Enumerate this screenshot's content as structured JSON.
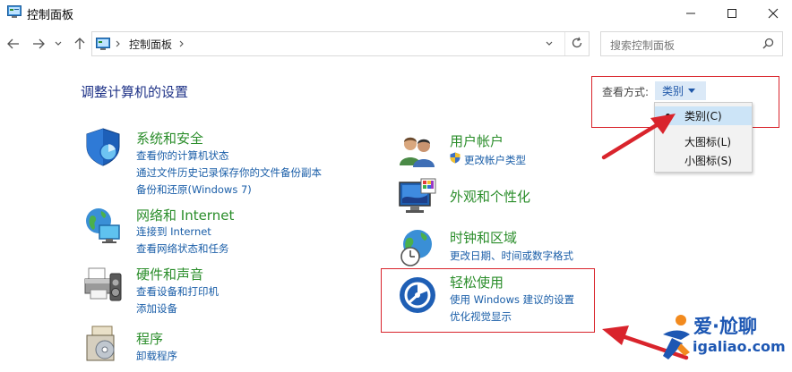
{
  "window": {
    "title": "控制面板"
  },
  "address_bar": {
    "path": "控制面板",
    "search_placeholder": "搜索控制面板"
  },
  "page": {
    "title": "调整计算机的设置",
    "view_by_label": "查看方式:",
    "view_by_value": "类别"
  },
  "view_menu": {
    "items": [
      "类别(C)",
      "大图标(L)",
      "小图标(S)"
    ],
    "selected": "类别(C)"
  },
  "left_categories": [
    {
      "heading": "系统和安全",
      "icon": "shield-icon",
      "links": [
        "查看你的计算机状态",
        "通过文件历史记录保存你的文件备份副本",
        "备份和还原(Windows 7)"
      ]
    },
    {
      "heading": "网络和 Internet",
      "icon": "network-globe-icon",
      "links": [
        "连接到 Internet",
        "查看网络状态和任务"
      ]
    },
    {
      "heading": "硬件和声音",
      "icon": "printer-icon",
      "links": [
        "查看设备和打印机",
        "添加设备"
      ]
    },
    {
      "heading": "程序",
      "icon": "programs-icon",
      "links": [
        "卸载程序"
      ]
    }
  ],
  "right_categories": [
    {
      "heading": "用户帐户",
      "icon": "users-icon",
      "links": [
        "更改帐户类型"
      ]
    },
    {
      "heading": "外观和个性化",
      "icon": "monitor-palette-icon",
      "links": []
    },
    {
      "heading": "时钟和区域",
      "icon": "clock-globe-icon",
      "links": [
        "更改日期、时间或数字格式"
      ]
    },
    {
      "heading": "轻松使用",
      "icon": "ease-of-access-icon",
      "links": [
        "使用 Windows 建议的设置",
        "优化视觉显示"
      ]
    }
  ],
  "watermark": {
    "brand": "爱·尬聊",
    "domain": "igaliao.com"
  },
  "colors": {
    "heading_green": "#2a8d2a",
    "link_blue": "#1a5ea8",
    "page_title_blue": "#1e3287",
    "annotation_red": "#d9242c"
  }
}
